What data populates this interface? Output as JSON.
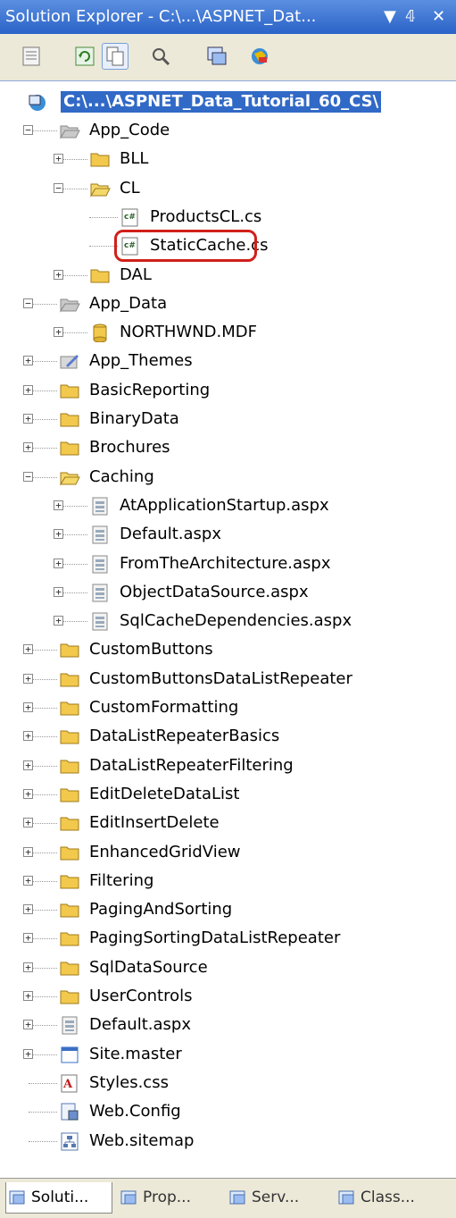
{
  "window": {
    "title": "Solution Explorer - C:\\...\\ASPNET_Dat...",
    "pin_glyph": "↓ 1",
    "close_glyph": "✕"
  },
  "toolbar": {
    "buttons": [
      {
        "name": "properties-icon"
      },
      {
        "name": "refresh-icon"
      },
      {
        "name": "show-all-files-icon"
      },
      {
        "name": "view-code-icon"
      },
      {
        "name": "copy-website-icon"
      },
      {
        "name": "asp-config-icon"
      }
    ]
  },
  "tree": {
    "root": "C:\\...\\ASPNET_Data_Tutorial_60_CS\\",
    "items": [
      {
        "label": "App_Code",
        "icon": "open-folder-gray",
        "depth": 1,
        "expander": "-"
      },
      {
        "label": "BLL",
        "icon": "folder",
        "depth": 2,
        "expander": "+"
      },
      {
        "label": "CL",
        "icon": "open-folder",
        "depth": 2,
        "expander": "-"
      },
      {
        "label": "ProductsCL.cs",
        "icon": "cs-file",
        "depth": 3,
        "expander": ""
      },
      {
        "label": "StaticCache.cs",
        "icon": "cs-file",
        "depth": 3,
        "expander": ""
      },
      {
        "label": "DAL",
        "icon": "folder",
        "depth": 2,
        "expander": "+"
      },
      {
        "label": "App_Data",
        "icon": "open-folder-gray",
        "depth": 1,
        "expander": "-"
      },
      {
        "label": "NORTHWND.MDF",
        "icon": "database",
        "depth": 2,
        "expander": "+"
      },
      {
        "label": "App_Themes",
        "icon": "themes-folder",
        "depth": 1,
        "expander": "+"
      },
      {
        "label": "BasicReporting",
        "icon": "folder",
        "depth": 1,
        "expander": "+"
      },
      {
        "label": "BinaryData",
        "icon": "folder",
        "depth": 1,
        "expander": "+"
      },
      {
        "label": "Brochures",
        "icon": "folder",
        "depth": 1,
        "expander": "+"
      },
      {
        "label": "Caching",
        "icon": "open-folder",
        "depth": 1,
        "expander": "-"
      },
      {
        "label": "AtApplicationStartup.aspx",
        "icon": "aspx-file",
        "depth": 2,
        "expander": "+"
      },
      {
        "label": "Default.aspx",
        "icon": "aspx-file",
        "depth": 2,
        "expander": "+"
      },
      {
        "label": "FromTheArchitecture.aspx",
        "icon": "aspx-file",
        "depth": 2,
        "expander": "+"
      },
      {
        "label": "ObjectDataSource.aspx",
        "icon": "aspx-file",
        "depth": 2,
        "expander": "+"
      },
      {
        "label": "SqlCacheDependencies.aspx",
        "icon": "aspx-file",
        "depth": 2,
        "expander": "+"
      },
      {
        "label": "CustomButtons",
        "icon": "folder",
        "depth": 1,
        "expander": "+"
      },
      {
        "label": "CustomButtonsDataListRepeater",
        "icon": "folder",
        "depth": 1,
        "expander": "+"
      },
      {
        "label": "CustomFormatting",
        "icon": "folder",
        "depth": 1,
        "expander": "+"
      },
      {
        "label": "DataListRepeaterBasics",
        "icon": "folder",
        "depth": 1,
        "expander": "+"
      },
      {
        "label": "DataListRepeaterFiltering",
        "icon": "folder",
        "depth": 1,
        "expander": "+"
      },
      {
        "label": "EditDeleteDataList",
        "icon": "folder",
        "depth": 1,
        "expander": "+"
      },
      {
        "label": "EditInsertDelete",
        "icon": "folder",
        "depth": 1,
        "expander": "+"
      },
      {
        "label": "EnhancedGridView",
        "icon": "folder",
        "depth": 1,
        "expander": "+"
      },
      {
        "label": "Filtering",
        "icon": "folder",
        "depth": 1,
        "expander": "+"
      },
      {
        "label": "PagingAndSorting",
        "icon": "folder",
        "depth": 1,
        "expander": "+"
      },
      {
        "label": "PagingSortingDataListRepeater",
        "icon": "folder",
        "depth": 1,
        "expander": "+"
      },
      {
        "label": "SqlDataSource",
        "icon": "folder",
        "depth": 1,
        "expander": "+"
      },
      {
        "label": "UserControls",
        "icon": "folder",
        "depth": 1,
        "expander": "+"
      },
      {
        "label": "Default.aspx",
        "icon": "aspx-file",
        "depth": 1,
        "expander": "+"
      },
      {
        "label": "Site.master",
        "icon": "master-file",
        "depth": 1,
        "expander": "+"
      },
      {
        "label": "Styles.css",
        "icon": "css-file",
        "depth": 1,
        "expander": ""
      },
      {
        "label": "Web.Config",
        "icon": "config-file",
        "depth": 1,
        "expander": ""
      },
      {
        "label": "Web.sitemap",
        "icon": "sitemap-file",
        "depth": 1,
        "expander": ""
      }
    ],
    "highlighted": "StaticCache.cs"
  },
  "tabs": [
    {
      "label": "Soluti...",
      "icon": "solution-explorer-icon",
      "active": true
    },
    {
      "label": "Prop...",
      "icon": "properties-icon",
      "active": false
    },
    {
      "label": "Serv...",
      "icon": "server-explorer-icon",
      "active": false
    },
    {
      "label": "Class...",
      "icon": "class-view-icon",
      "active": false
    }
  ],
  "colors": {
    "title_bar": "#2a63c8",
    "selection": "#3169c6",
    "highlight_ring": "#d0201a",
    "folder": "#f2c94c"
  }
}
